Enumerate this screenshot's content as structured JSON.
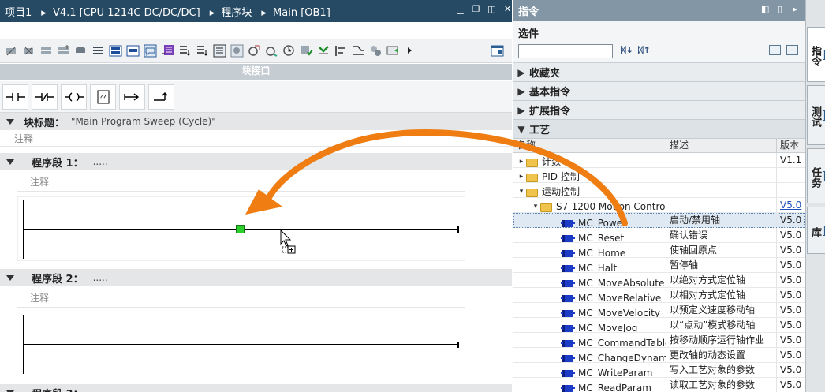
{
  "editor": {
    "breadcrumb": [
      "项目1",
      "V4.1 [CPU 1214C DC/DC/DC]",
      "程序块",
      "Main [OB1]"
    ],
    "block_interface_label": "块接口",
    "ladder_buttons": [
      "⊣⊢",
      "⊣/⊢",
      "–( )–",
      "??",
      "↦",
      "↗"
    ],
    "block_title_label": "块标题：",
    "block_title_value": "\"Main Program Sweep (Cycle)\"",
    "block_comment": "注释",
    "networks": [
      {
        "label": "程序段 1：",
        "dots": ".....",
        "comment": "注释"
      },
      {
        "label": "程序段 2：",
        "dots": ".....",
        "comment": "注释"
      },
      {
        "label": "程序段 3：",
        "dots": "....."
      }
    ]
  },
  "panel": {
    "title": "指令",
    "options_label": "选件",
    "search_value": "",
    "panes": [
      {
        "label": "收藏夹",
        "expanded": false
      },
      {
        "label": "基本指令",
        "expanded": false
      },
      {
        "label": "扩展指令",
        "expanded": false
      },
      {
        "label": "工艺",
        "expanded": true
      }
    ],
    "columns": [
      "名称",
      "描述",
      "版本"
    ],
    "rows": [
      {
        "name": "计数",
        "desc": "",
        "ver": "V1.1",
        "level": 0,
        "type": "folder",
        "expander": "▸"
      },
      {
        "name": "PID 控制",
        "desc": "",
        "ver": "",
        "level": 0,
        "type": "folder",
        "expander": "▸"
      },
      {
        "name": "运动控制",
        "desc": "",
        "ver": "",
        "level": 0,
        "type": "folder",
        "expander": "▾"
      },
      {
        "name": "S7-1200 Motion Control",
        "desc": "",
        "ver": "V5.0",
        "level": 1,
        "type": "folder",
        "expander": "▾",
        "ver_link": true
      },
      {
        "name": "MC_Power",
        "desc": "启动/禁用轴",
        "ver": "V5.0",
        "level": 2,
        "type": "instr",
        "selected": true
      },
      {
        "name": "MC_Reset",
        "desc": "确认错误",
        "ver": "V5.0",
        "level": 2,
        "type": "instr"
      },
      {
        "name": "MC_Home",
        "desc": "使轴回原点",
        "ver": "V5.0",
        "level": 2,
        "type": "instr"
      },
      {
        "name": "MC_Halt",
        "desc": "暂停轴",
        "ver": "V5.0",
        "level": 2,
        "type": "instr"
      },
      {
        "name": "MC_MoveAbsolute",
        "desc": "以绝对方式定位轴",
        "ver": "V5.0",
        "level": 2,
        "type": "instr"
      },
      {
        "name": "MC_MoveRelative",
        "desc": "以相对方式定位轴",
        "ver": "V5.0",
        "level": 2,
        "type": "instr"
      },
      {
        "name": "MC_MoveVelocity",
        "desc": "以预定义速度移动轴",
        "ver": "V5.0",
        "level": 2,
        "type": "instr"
      },
      {
        "name": "MC_MoveJog",
        "desc": "以“点动”模式移动轴",
        "ver": "V5.0",
        "level": 2,
        "type": "instr"
      },
      {
        "name": "MC_CommandTable",
        "desc": "按移动顺序运行轴作业",
        "ver": "V5.0",
        "level": 2,
        "type": "instr"
      },
      {
        "name": "MC_ChangeDynamic",
        "desc": "更改轴的动态设置",
        "ver": "V5.0",
        "level": 2,
        "type": "instr"
      },
      {
        "name": "MC_WriteParam",
        "desc": "写入工艺对象的参数",
        "ver": "V5.0",
        "level": 2,
        "type": "instr"
      },
      {
        "name": "MC_ReadParam",
        "desc": "读取工艺对象的参数",
        "ver": "V5.0",
        "level": 2,
        "type": "instr"
      }
    ]
  },
  "side_tabs": [
    "指令",
    "测试",
    "任务",
    "库"
  ],
  "colors": {
    "title_bar": "#264a63",
    "panel_title": "#8396a6",
    "drag_arrow": "#ef7d12",
    "drop_point": "#2ccf2c"
  }
}
